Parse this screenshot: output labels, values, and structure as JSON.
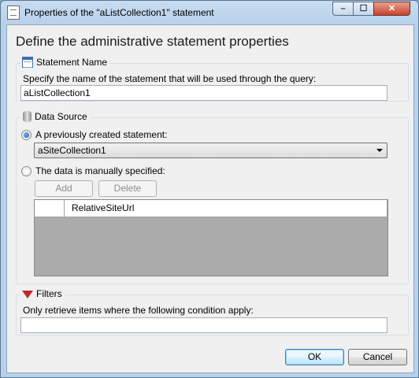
{
  "window": {
    "title": "Properties of the \"aListCollection1\" statement",
    "controls": {
      "minimize": "–",
      "maximize": "☐",
      "close": "✕"
    }
  },
  "heading": "Define the administrative statement properties",
  "statement_name": {
    "group_title": "Statement Name",
    "icon": "table-icon",
    "description": "Specify the name of the statement that will be used through the query:",
    "value": "aListCollection1"
  },
  "data_source": {
    "group_title": "Data Source",
    "icon": "database-icon",
    "option_previous": {
      "label": "A previously created statement:",
      "checked": true
    },
    "combo_value": "aSiteCollection1",
    "option_manual": {
      "label": "The data is manually specified:",
      "checked": false
    },
    "add_label": "Add",
    "delete_label": "Delete",
    "grid": {
      "columns": [
        "RelativeSiteUrl"
      ]
    }
  },
  "filters": {
    "group_title": "Filters",
    "icon": "filter-icon",
    "description": "Only retrieve items where the following condition apply:",
    "value": ""
  },
  "buttons": {
    "ok": "OK",
    "cancel": "Cancel"
  },
  "colors": {
    "title_bar": "#b8d1ea",
    "close_button": "#c8432e",
    "grid_background": "#ababab",
    "dialog_background": "#f0f0f0"
  }
}
